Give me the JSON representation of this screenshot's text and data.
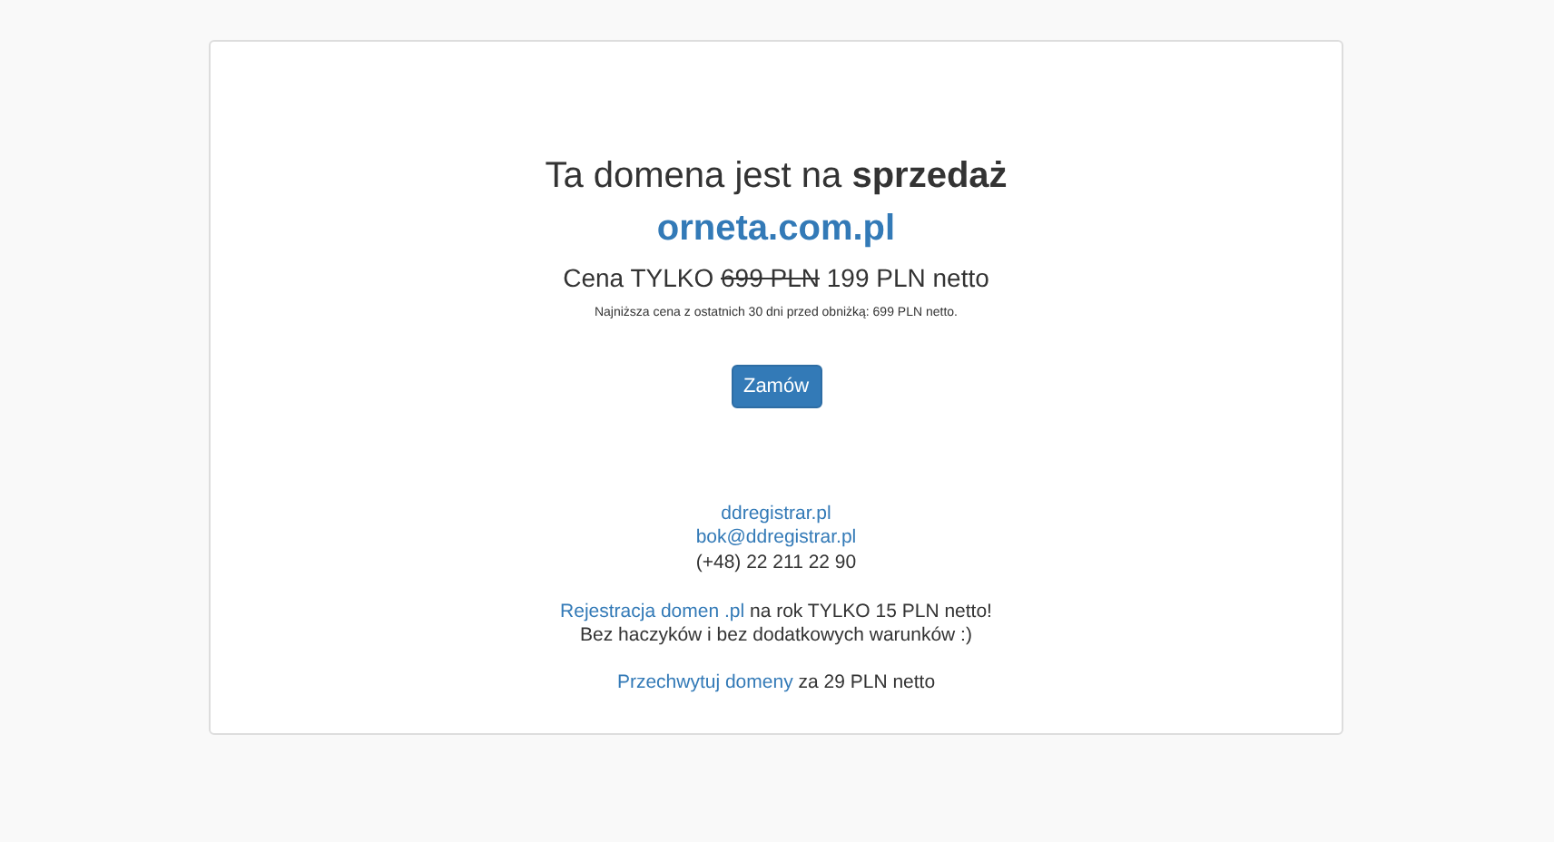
{
  "heading": "Ta domena jest na **sprzedaż**",
  "domain": "orneta.com.pl",
  "price": {
    "label": "Cena TYLKO",
    "old_price": "699 PLN",
    "new_price": "199 PLN netto"
  },
  "price_note": "Najniższa cena z ostatnich 30 dni przed obniżką: 699 PLN netto.",
  "order_button": "Zamów",
  "contact": [
    {
      "kind": "link",
      "text": "ddregistrar.pl"
    },
    {
      "kind": "link",
      "text": "bok@ddregistrar.pl"
    },
    {
      "kind": "text",
      "text": "(+48) 22 211 22 90"
    }
  ],
  "promos": [
    {
      "link": "Rejestracja domen .pl",
      "text": "na rok TYLKO 15 PLN netto!"
    },
    {
      "text": "Bez haczyków i bez dodatkowych warunków :)"
    },
    {
      "link": "Przechwytuj domeny",
      "text": "za 29 PLN netto"
    }
  ]
}
